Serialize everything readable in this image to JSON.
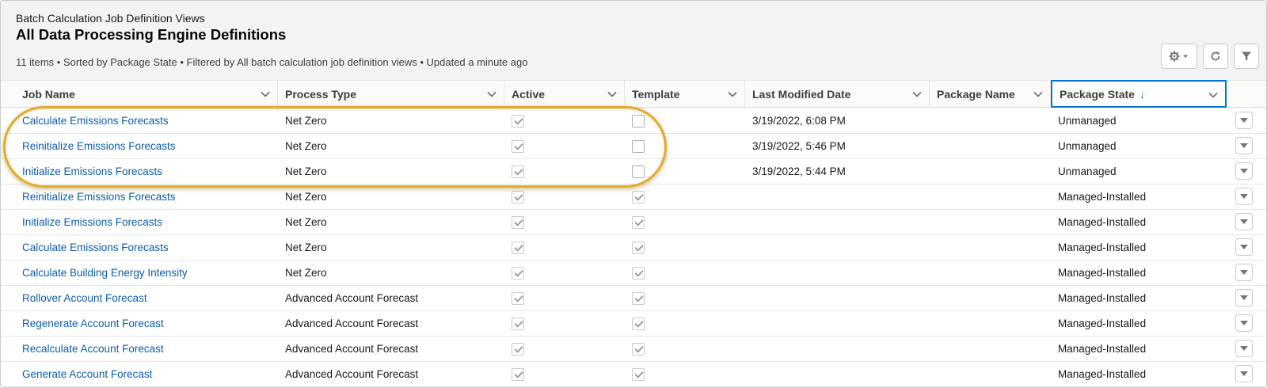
{
  "header": {
    "object_label": "Batch Calculation Job Definition Views",
    "list_title": "All Data Processing Engine Definitions",
    "info_line": "11 items • Sorted by Package State • Filtered by All batch calculation job definition views • Updated a minute ago"
  },
  "toolbar": {
    "settings_icon": "gear-icon",
    "refresh_icon": "refresh-icon",
    "filter_icon": "filter-icon"
  },
  "columns": [
    {
      "label": "Job Name"
    },
    {
      "label": "Process Type"
    },
    {
      "label": "Active"
    },
    {
      "label": "Template"
    },
    {
      "label": "Last Modified Date"
    },
    {
      "label": "Package Name"
    },
    {
      "label": "Package State",
      "sorted": "descending"
    }
  ],
  "rows": [
    {
      "job_name": "Calculate Emissions Forecasts",
      "process_type": "Net Zero",
      "active": true,
      "template": false,
      "last_modified": "3/19/2022, 6:08 PM",
      "package_name": "",
      "package_state": "Unmanaged"
    },
    {
      "job_name": "Reinitialize Emissions Forecasts",
      "process_type": "Net Zero",
      "active": true,
      "template": false,
      "last_modified": "3/19/2022, 5:46 PM",
      "package_name": "",
      "package_state": "Unmanaged"
    },
    {
      "job_name": "Initialize Emissions Forecasts",
      "process_type": "Net Zero",
      "active": true,
      "template": false,
      "last_modified": "3/19/2022, 5:44 PM",
      "package_name": "",
      "package_state": "Unmanaged"
    },
    {
      "job_name": "Reinitialize Emissions Forecasts",
      "process_type": "Net Zero",
      "active": true,
      "template": true,
      "last_modified": "",
      "package_name": "",
      "package_state": "Managed-Installed"
    },
    {
      "job_name": "Initialize Emissions Forecasts",
      "process_type": "Net Zero",
      "active": true,
      "template": true,
      "last_modified": "",
      "package_name": "",
      "package_state": "Managed-Installed"
    },
    {
      "job_name": "Calculate Emissions Forecasts",
      "process_type": "Net Zero",
      "active": true,
      "template": true,
      "last_modified": "",
      "package_name": "",
      "package_state": "Managed-Installed"
    },
    {
      "job_name": "Calculate Building Energy Intensity",
      "process_type": "Net Zero",
      "active": true,
      "template": true,
      "last_modified": "",
      "package_name": "",
      "package_state": "Managed-Installed"
    },
    {
      "job_name": "Rollover Account Forecast",
      "process_type": "Advanced Account Forecast",
      "active": true,
      "template": true,
      "last_modified": "",
      "package_name": "",
      "package_state": "Managed-Installed"
    },
    {
      "job_name": "Regenerate Account Forecast",
      "process_type": "Advanced Account Forecast",
      "active": true,
      "template": true,
      "last_modified": "",
      "package_name": "",
      "package_state": "Managed-Installed"
    },
    {
      "job_name": "Recalculate Account Forecast",
      "process_type": "Advanced Account Forecast",
      "active": true,
      "template": true,
      "last_modified": "",
      "package_name": "",
      "package_state": "Managed-Installed"
    },
    {
      "job_name": "Generate Account Forecast",
      "process_type": "Advanced Account Forecast",
      "active": true,
      "template": true,
      "last_modified": "",
      "package_name": "",
      "package_state": "Managed-Installed"
    }
  ],
  "colors": {
    "link": "#0b5cab",
    "sort_accent": "#0176d3",
    "highlight_ring": "#e0ac2c"
  }
}
